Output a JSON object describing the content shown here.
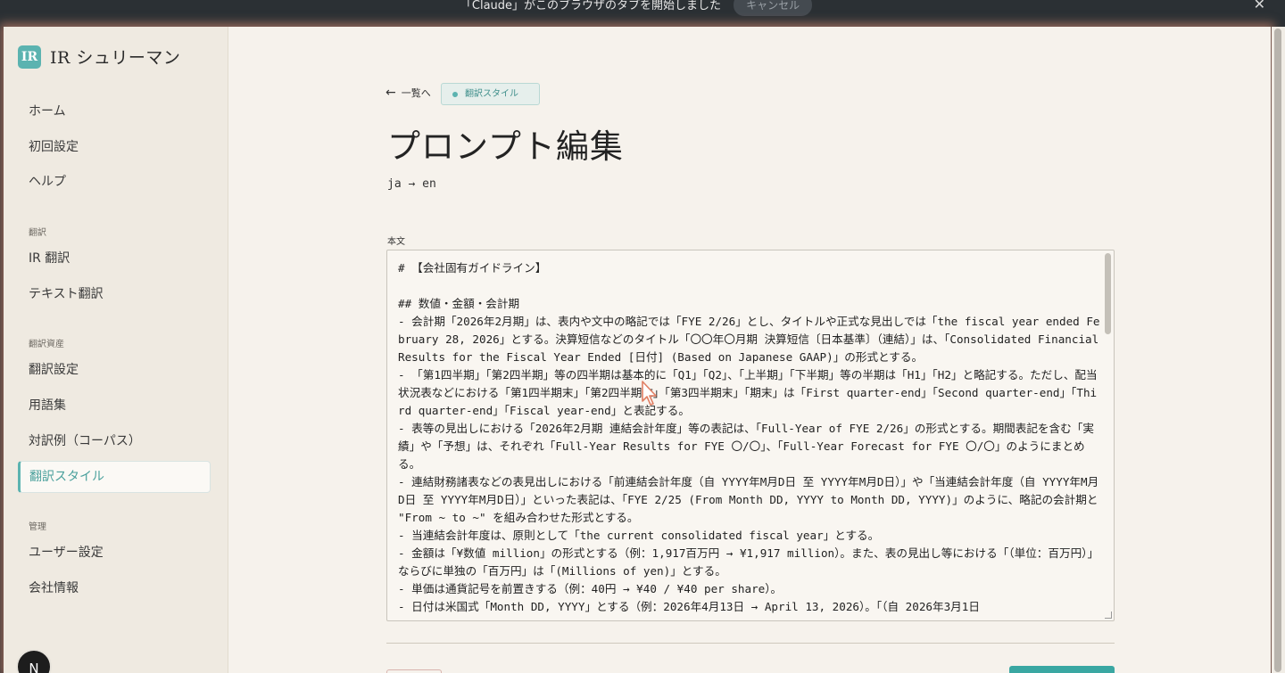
{
  "notification": {
    "message": "「Claude」がこのブラウザのタブを開始しました",
    "cancel_label": "キャンセル",
    "close_label": "✕"
  },
  "app": {
    "logo_mark": "IR",
    "logo_text": "IR シュリーマン",
    "accent": "#5bb3b0"
  },
  "sidebar": {
    "items_top": [
      "ホーム",
      "初回設定",
      "ヘルプ"
    ],
    "section_translation": "翻訳",
    "items_translation": [
      "IR 翻訳",
      "テキスト翻訳"
    ],
    "section_assets": "翻訳資産",
    "items_assets": [
      "翻訳設定",
      "用語集",
      "対訳例（コーパス）",
      "翻訳スタイル"
    ],
    "active_item": "翻訳スタイル",
    "section_admin": "管理",
    "items_admin": [
      "ユーザー設定",
      "会社情報"
    ],
    "avatar_initial": "N"
  },
  "main": {
    "back_arrow": "←",
    "back_label": "一覧へ",
    "badge_label": "翻訳スタイル",
    "page_title": "プロンプト編集",
    "lang_pair": "ja → en",
    "body_label": "本文",
    "body_text": "# 【会社固有ガイドライン】\n\n## 数値・金額・会計期\n- 会計期「2026年2月期」は、表内や文中の略記では「FYE 2/26」とし、タイトルや正式な見出しでは「the fiscal year ended February 28, 2026」とする。決算短信などのタイトル「〇〇年〇月期 決算短信〔日本基準〕（連結）」は、「Consolidated Financial Results for the Fiscal Year Ended [日付] (Based on Japanese GAAP)」の形式とする。\n- 「第1四半期」「第2四半期」等の四半期は基本的に「Q1」「Q2」、「上半期」「下半期」等の半期は「H1」「H2」と略記する。ただし、配当状況表などにおける「第1四半期末」「第2四半期末」「第3四半期末」「期末」は「First quarter-end」「Second quarter-end」「Third quarter-end」「Fiscal year-end」と表記する。\n- 表等の見出しにおける「2026年2月期 連結会計年度」等の表記は、「Full-Year of FYE 2/26」の形式とする。期間表記を含む「実績」や「予想」は、それぞれ「Full-Year Results for FYE 〇/〇」、「Full-Year Forecast for FYE 〇/〇」のようにまとめる。\n- 連結財務諸表などの表見出しにおける「前連結会計年度（自 YYYY年M月D日 至 YYYY年M月D日）」や「当連結会計年度（自 YYYY年M月D日 至 YYYY年M月D日）」といった表記は、「FYE 2/25 (From Month DD, YYYY to Month DD, YYYY)」のように、略記の会計期と \"From ~ to ~\" を組み合わせた形式とする。\n- 当連結会計年度は、原則として「the current consolidated fiscal year」とする。\n- 金額は「¥数値 million」の形式とする（例：1,917百万円 → ¥1,917 million）。また、表の見出し等における「（単位：百万円）」ならびに単独の「百万円」は「(Millions of yen)」とする。\n- 単価は通貨記号を前置きする（例：40円 → ¥40 / ¥40 per share）。\n- 日付は米国式「Month DD, YYYY」とする（例：2026年4月13日 → April 13, 2026）。「（自 2026年3月1日"
  }
}
